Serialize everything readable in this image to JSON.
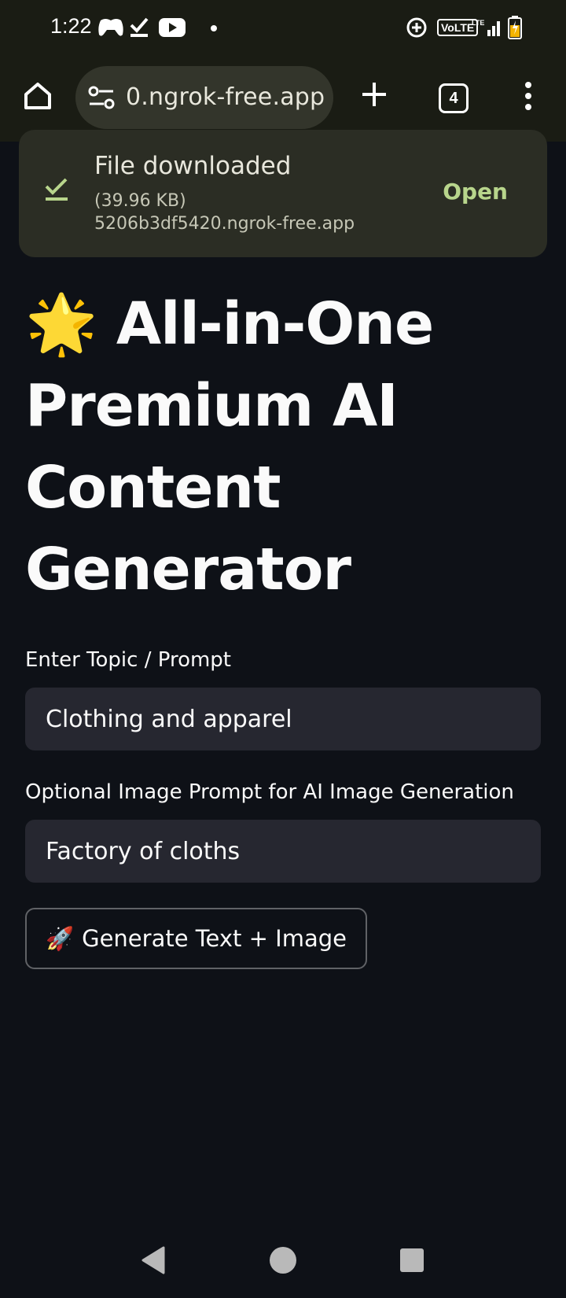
{
  "status_bar": {
    "time": "1:22",
    "volte": "VoLTE",
    "lte": "LTE"
  },
  "browser": {
    "url_text": "0.ngrok-free.app",
    "tab_count": "4"
  },
  "download_toast": {
    "title": "File downloaded",
    "size": "(39.96 KB)",
    "host": "5206b3df5420.ngrok-free.app",
    "action": "Open"
  },
  "main": {
    "title_emoji": "🌟",
    "title": "All-in-One Premium AI Content Generator",
    "topic_label": "Enter Topic / Prompt",
    "topic_value": "Clothing and apparel",
    "image_prompt_label": "Optional Image Prompt for AI Image Generation",
    "image_prompt_value": "Factory of cloths",
    "generate_emoji": "🚀",
    "generate_label": "Generate Text + Image"
  },
  "colors": {
    "page_bg": "#0e1117",
    "chrome_bg": "#1a1c14",
    "input_bg": "#262730",
    "toast_bg": "#2b2d24",
    "accent_green": "#b8d58c"
  }
}
